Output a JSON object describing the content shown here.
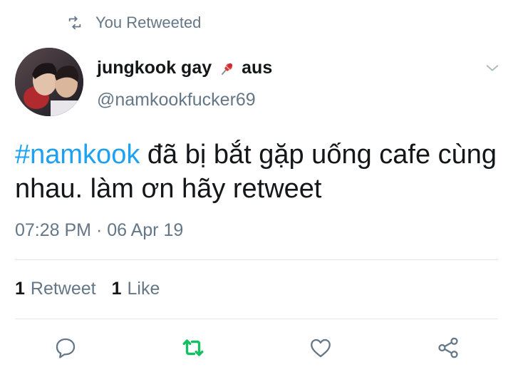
{
  "retweet_header": {
    "icon": "retweet-icon",
    "text": "You Retweeted"
  },
  "author": {
    "display_name": "jungkook gay",
    "name_suffix": "aus",
    "pin_icon": "pushpin-icon",
    "handle": "@namkookfucker69"
  },
  "tweet": {
    "hashtag": "#namkook",
    "text": " đã bị bắt gặp uống cafe cùng nhau. làm ơn hãy retweet",
    "timestamp": "07:28 PM · 06 Apr 19"
  },
  "stats": {
    "retweets_count": "1",
    "retweets_label": "Retweet",
    "likes_count": "1",
    "likes_label": "Like"
  },
  "actions": [
    {
      "name": "reply",
      "icon": "comment-icon"
    },
    {
      "name": "retweet",
      "icon": "retweet-icon",
      "active_color": "#17bf63"
    },
    {
      "name": "like",
      "icon": "heart-icon"
    },
    {
      "name": "share",
      "icon": "share-icon"
    }
  ],
  "colors": {
    "hashtag": "#1da1f2",
    "secondary_text": "#657786",
    "retweet_active": "#17bf63",
    "divider": "#e1e8ed"
  }
}
